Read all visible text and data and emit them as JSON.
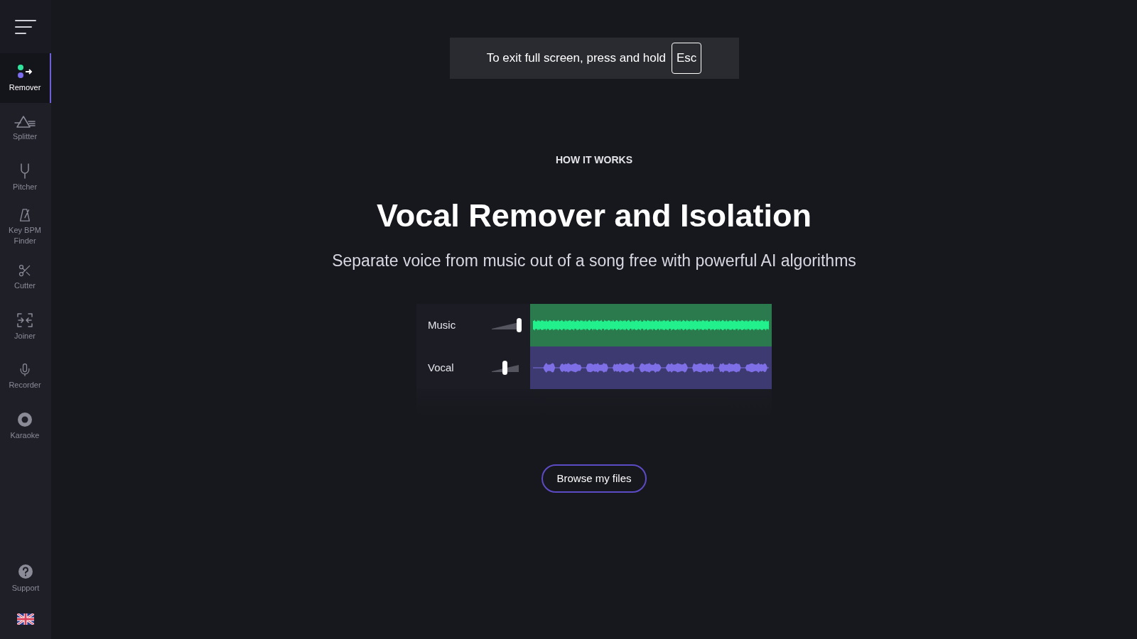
{
  "sidebar": {
    "items": [
      {
        "kind": "remover",
        "label": "Remover",
        "selected": true
      },
      {
        "kind": "splitter",
        "label": "Splitter",
        "selected": false
      },
      {
        "kind": "pitcher",
        "label": "Pitcher",
        "selected": false
      },
      {
        "kind": "bpm",
        "label": "Key BPM Finder",
        "selected": false
      },
      {
        "kind": "cutter",
        "label": "Cutter",
        "selected": false
      },
      {
        "kind": "joiner",
        "label": "Joiner",
        "selected": false
      },
      {
        "kind": "recorder",
        "label": "Recorder",
        "selected": false
      },
      {
        "kind": "karaoke",
        "label": "Karaoke",
        "selected": false
      }
    ],
    "support": "Support"
  },
  "fullscreen_notice": {
    "text": "To exit full screen, press and hold",
    "key": "Esc"
  },
  "eyebrow": "HOW IT WORKS",
  "title": "Vocal Remover and Isolation",
  "subtitle": "Separate voice from music out of a song free with powerful AI algorithms",
  "tracks": [
    {
      "kind": "music",
      "name": "Music",
      "level": 1
    },
    {
      "kind": "vocal",
      "name": "Vocal",
      "level": 0.45
    }
  ],
  "browse_button": "Browse my files"
}
